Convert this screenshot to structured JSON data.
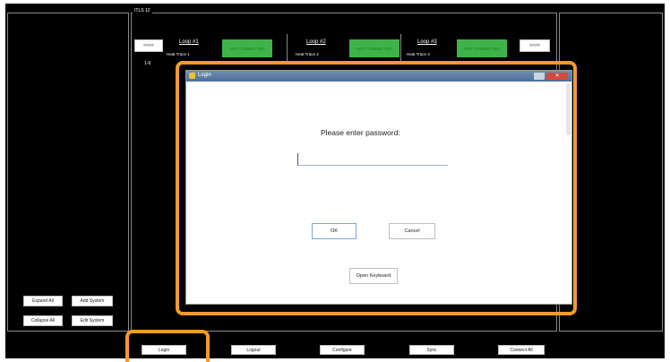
{
  "app": {
    "title": "ITLS 12",
    "page_range": "1-6"
  },
  "nav": {
    "prev_label": "<<<<",
    "next_label": ">>>>"
  },
  "loops": [
    {
      "title": "Loop #1",
      "subtitle": "Heat Trace 1",
      "status": "NOT CONNECTED"
    },
    {
      "title": "Loop #2",
      "subtitle": "Heat Trace 2",
      "status": "NOT CONNECTED"
    },
    {
      "title": "Loop #3",
      "subtitle": "Heat Trace 3",
      "status": "NOT CONNECTED"
    }
  ],
  "sidebar": {
    "expand_all": "Expand All",
    "add_system": "Add System",
    "collapse_all": "Collapse All",
    "edit_system": "Edit System"
  },
  "toolbar": {
    "login": "Login",
    "logout": "Logout",
    "configure": "Configure",
    "sync": "Sync",
    "connect_all": "Connect All"
  },
  "dialog": {
    "title": "Login",
    "prompt": "Please enter password:",
    "password_value": "",
    "ok_label": "OK",
    "cancel_label": "Cancel",
    "open_keyboard_label": "Open Keyboard"
  },
  "colors": {
    "highlight": "#f39a2c",
    "status_green": "#3fb34a",
    "background": "#000000"
  }
}
